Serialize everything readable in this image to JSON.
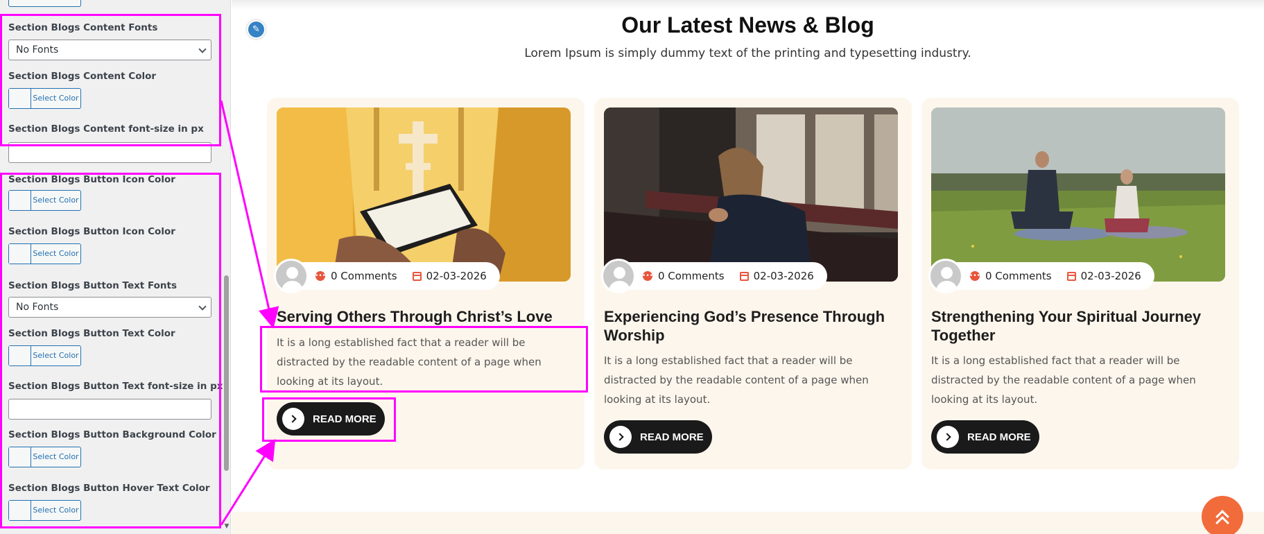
{
  "sidebar": {
    "select_color_label": "Select Color",
    "fields": {
      "content_fonts_label": "Section Blogs Content Fonts",
      "content_fonts_value": "No Fonts",
      "content_color_label": "Section Blogs Content Color",
      "content_fontsize_label": "Section Blogs Content font-size in px",
      "button_icon_color_label_1": "Section Blogs Button Icon Color",
      "button_icon_color_label_2": "Section Blogs Button Icon Color",
      "button_text_fonts_label": "Section Blogs Button Text Fonts",
      "button_text_fonts_value": "No Fonts",
      "button_text_color_label": "Section Blogs Button Text Color",
      "button_text_fontsize_label": "Section Blogs Button Text font-size in px",
      "button_bg_color_label": "Section Blogs Button Background Color",
      "button_hover_text_color_label": "Section Blogs Button Hover Text Color"
    }
  },
  "section": {
    "title": "Our Latest News & Blog",
    "subtitle": "Lorem Ipsum is simply dummy text of the printing and typesetting industry."
  },
  "cards": [
    {
      "comments": "0 Comments",
      "date": "02-03-2026",
      "title": "Serving Others Through Christ’s Love",
      "description": "It is a long established fact that a reader will be distracted by the readable content of a page when looking at its layout.",
      "button": "READ MORE"
    },
    {
      "comments": "0 Comments",
      "date": "02-03-2026",
      "title": "Experiencing God’s Presence Through Worship",
      "description": "It is a long established fact that a reader will be distracted by the readable content of a page when looking at its layout.",
      "button": "READ MORE"
    },
    {
      "comments": "0 Comments",
      "date": "02-03-2026",
      "title": "Strengthening Your Spiritual Journey Together",
      "description": "It is a long established fact that a reader will be distracted by the readable content of a page when looking at its layout.",
      "button": "READ MORE"
    }
  ],
  "colors": {
    "highlight": "#ff00ff",
    "accent": "#e8553c",
    "card_bg": "#fdf6ec",
    "button_bg": "#1a1a1a",
    "scroll_top": "#f26b3a"
  }
}
